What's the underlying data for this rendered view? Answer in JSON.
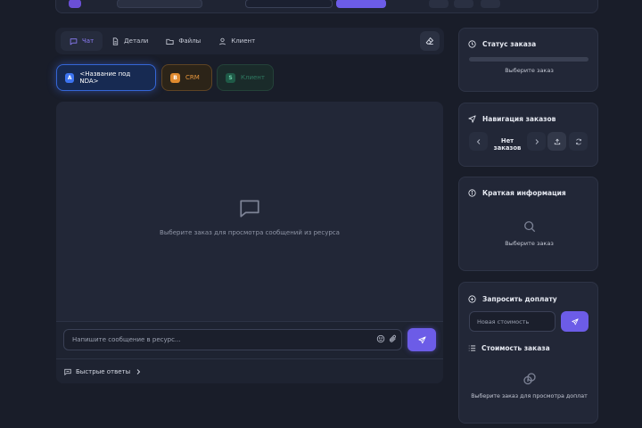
{
  "tabs": [
    {
      "label": "Чат",
      "icon": "chat-icon",
      "active": true
    },
    {
      "label": "Детали",
      "icon": "document-icon",
      "active": false
    },
    {
      "label": "Файлы",
      "icon": "folder-icon",
      "active": false
    },
    {
      "label": "Клиент",
      "icon": "user-icon",
      "active": false
    }
  ],
  "resources": [
    {
      "badge": "A",
      "label": "<Название под NDA>",
      "color": "#3d74f0",
      "active": true
    },
    {
      "badge": "B",
      "label": "CRM",
      "color": "#e08a2e",
      "active": false
    },
    {
      "badge": "S",
      "label": "Клиент",
      "color": "#1f5a47",
      "active": false
    }
  ],
  "chat": {
    "empty_text": "Выберите заказ для просмотра сообщений из ресурса",
    "input_placeholder": "Напишите сообщение в ресурс...",
    "quick_replies_label": "Быстрые ответы"
  },
  "status_card": {
    "title": "Статус заказа",
    "progress": 0,
    "text": "Выберите заказ"
  },
  "nav_card": {
    "title": "Навигация заказов",
    "label": "Нет заказов"
  },
  "info_card": {
    "title": "Краткая информация",
    "empty_text": "Выберите заказ"
  },
  "payment_card": {
    "title": "Запросить доплату",
    "input_placeholder": "Новая стоимость",
    "cost_title": "Стоимость заказа",
    "cost_empty_text": "Выберите заказ для просмотра доплат"
  },
  "colors": {
    "accent": "#6c5ce7",
    "background": "#191d29",
    "panel": "#222737"
  }
}
